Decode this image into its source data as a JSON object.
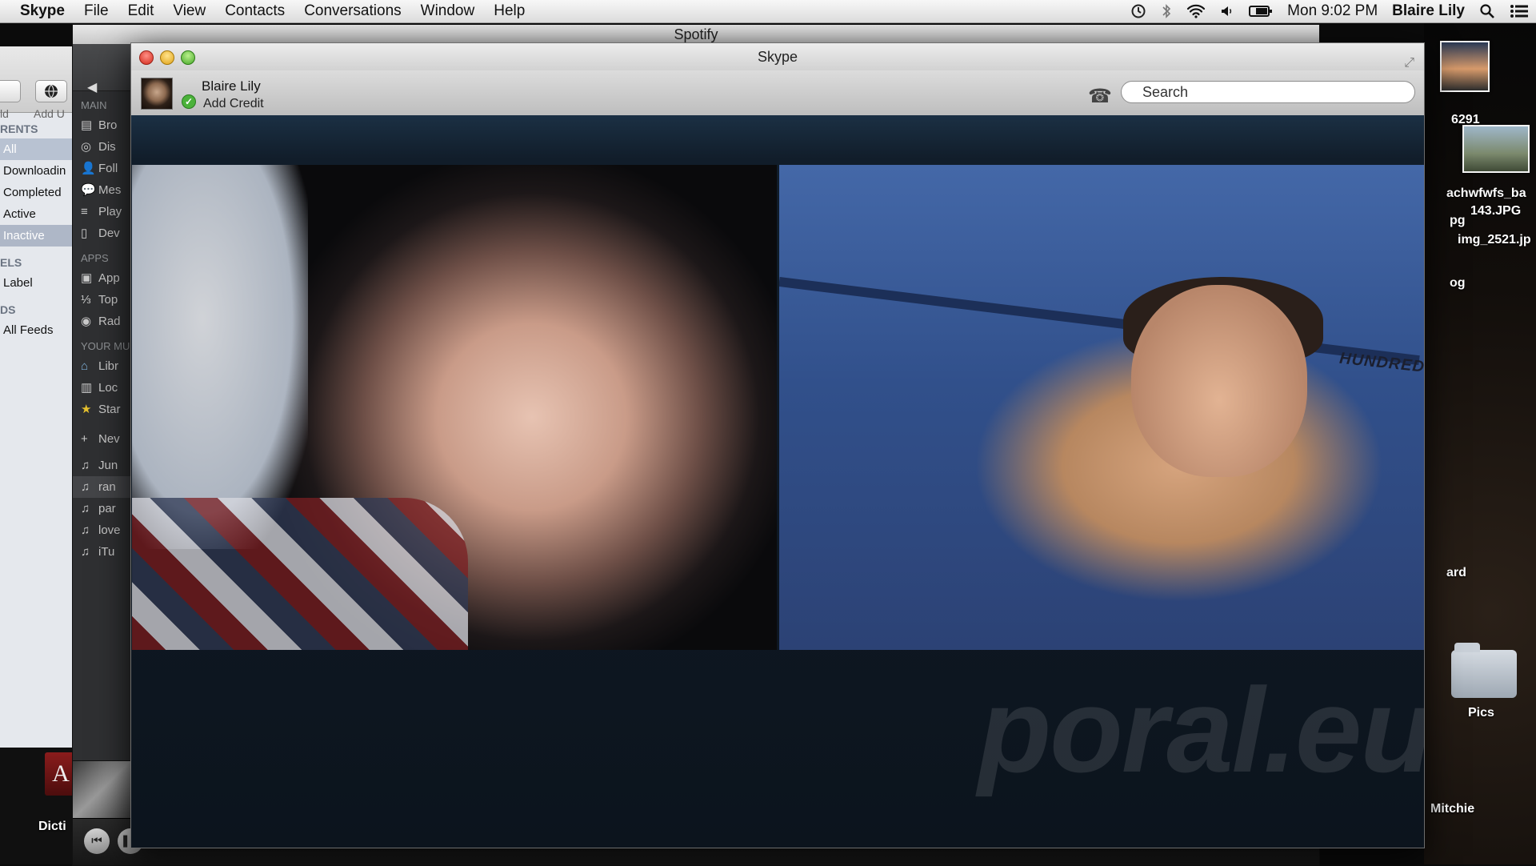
{
  "menubar": {
    "app": "Skype",
    "menus": [
      "File",
      "Edit",
      "View",
      "Contacts",
      "Conversations",
      "Window",
      "Help"
    ],
    "datetime": "Mon 9:02 PM",
    "user": "Blaire Lily"
  },
  "torrent_window": {
    "toolbar": {
      "left_label": "ld",
      "add_label": "Add U"
    },
    "sections": [
      {
        "title": "RENTS",
        "items": [
          "All",
          "Downloadin",
          "Completed",
          "Active",
          "Inactive"
        ]
      },
      {
        "title": "ELS",
        "items": [
          "Label"
        ]
      },
      {
        "title": "DS",
        "items": [
          "All Feeds"
        ]
      }
    ]
  },
  "spotify": {
    "title": "Spotify",
    "main_header": "MAIN",
    "main_items": [
      "Bro",
      "Dis",
      "Foll",
      "Mes",
      "Play",
      "Dev"
    ],
    "apps_header": "APPS",
    "apps_items": [
      "App",
      "Top",
      "Rad"
    ],
    "your_music_header": "YOUR MU",
    "your_music_items": [
      "Libr",
      "Loc",
      "Star"
    ],
    "new_playlist": "Nev",
    "playlists": [
      "Jun",
      "ran",
      "par",
      "love",
      "iTu"
    ]
  },
  "skype": {
    "title": "Skype",
    "user_name": "Blaire Lily",
    "credit_label": "Add Credit",
    "search_placeholder": "Search",
    "video_overlay_text": "HUNDREDS T",
    "watermark": "poral.eu"
  },
  "desktop": {
    "labels": [
      "6291",
      "achwfwfs_ba",
      "143.JPG",
      "pg",
      "img_2521.jp",
      "og",
      "ard",
      "Pics",
      "Mitchie"
    ],
    "dock_label": "Dicti"
  }
}
